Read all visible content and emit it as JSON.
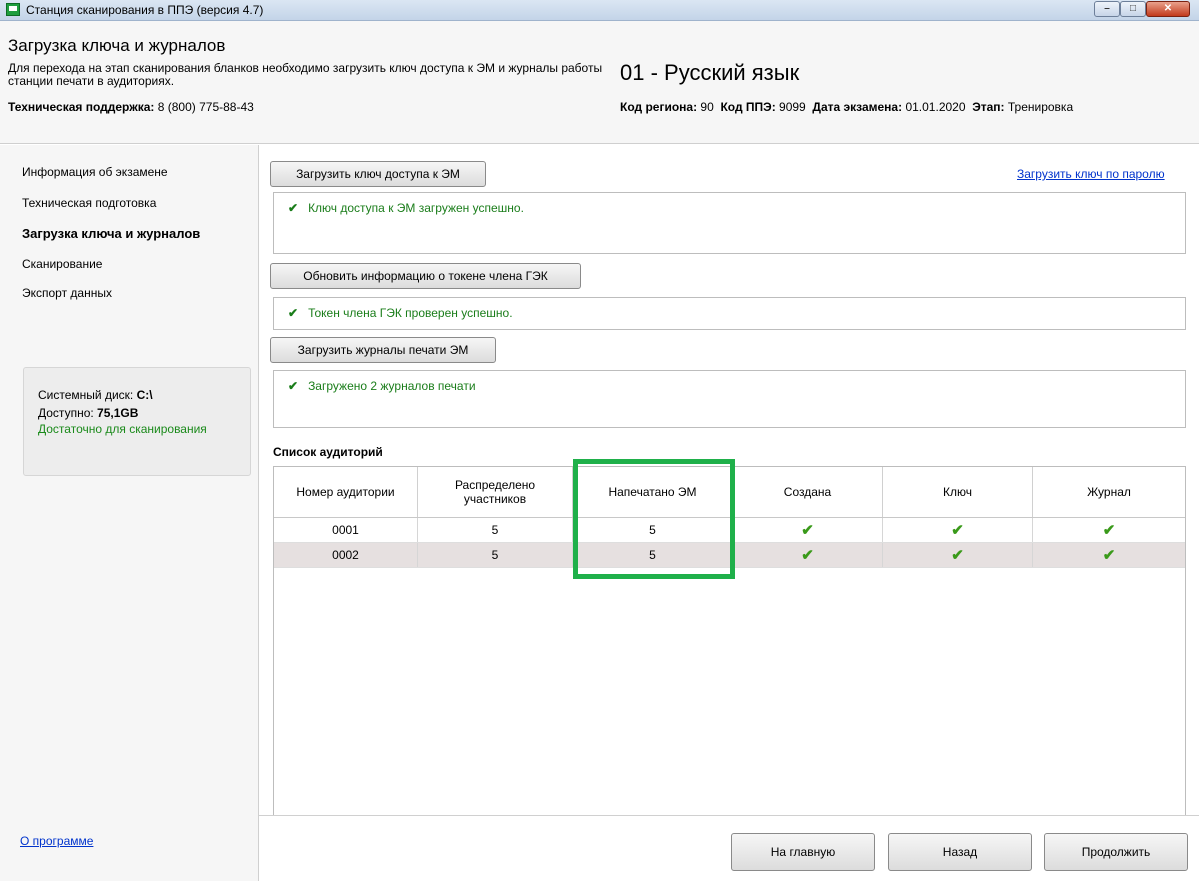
{
  "window": {
    "title": "Станция сканирования в ППЭ (версия 4.7)"
  },
  "header": {
    "title": "Загрузка ключа и журналов",
    "description": "Для перехода на этап сканирования бланков необходимо загрузить ключ доступа к ЭМ и журналы работы станции печати в аудиториях.",
    "support_label": "Техническая поддержка:",
    "support_phone": "8 (800) 775-88-43",
    "subject": "01 - Русский язык",
    "region_label": "Код региона:",
    "region_value": "90",
    "ppe_label": "Код ППЭ:",
    "ppe_value": "9099",
    "date_label": "Дата экзамена:",
    "date_value": "01.01.2020",
    "stage_label": "Этап:",
    "stage_value": "Тренировка"
  },
  "sidebar": {
    "items": [
      {
        "label": "Информация об экзамене"
      },
      {
        "label": "Техническая подготовка"
      },
      {
        "label": "Загрузка ключа и журналов"
      },
      {
        "label": "Сканирование"
      },
      {
        "label": "Экспорт данных"
      }
    ],
    "disk": {
      "label": "Системный диск:",
      "value": "C:\\",
      "free_label": "Доступно:",
      "free_value": "75,1GB",
      "status": "Достаточно для сканирования"
    },
    "about": "О программе"
  },
  "main": {
    "load_key_button": "Загрузить ключ доступа к ЭМ",
    "load_key_password_link": "Загрузить ключ по паролю",
    "key_status": "Ключ доступа к ЭМ загружен успешно.",
    "update_token_button": "Обновить информацию о токене члена ГЭК",
    "token_status": "Токен члена ГЭК проверен успешно.",
    "load_logs_button": "Загрузить журналы печати ЭМ",
    "logs_status": "Загружено 2 журналов печати",
    "check_glyph": "✔",
    "table_title": "Список аудиторий",
    "columns": [
      "Номер аудитории",
      "Распределено участников",
      "Напечатано ЭМ",
      "Создана",
      "Ключ",
      "Журнал"
    ],
    "rows": [
      {
        "room": "0001",
        "assigned": "5",
        "printed": "5"
      },
      {
        "room": "0002",
        "assigned": "5",
        "printed": "5"
      }
    ]
  },
  "footer": {
    "home_button": "На главную",
    "back_button": "Назад",
    "continue_button": "Продолжить"
  },
  "colors": {
    "highlight": "#1fb04a",
    "success_text": "#1a7d1a",
    "link": "#0033cc"
  }
}
